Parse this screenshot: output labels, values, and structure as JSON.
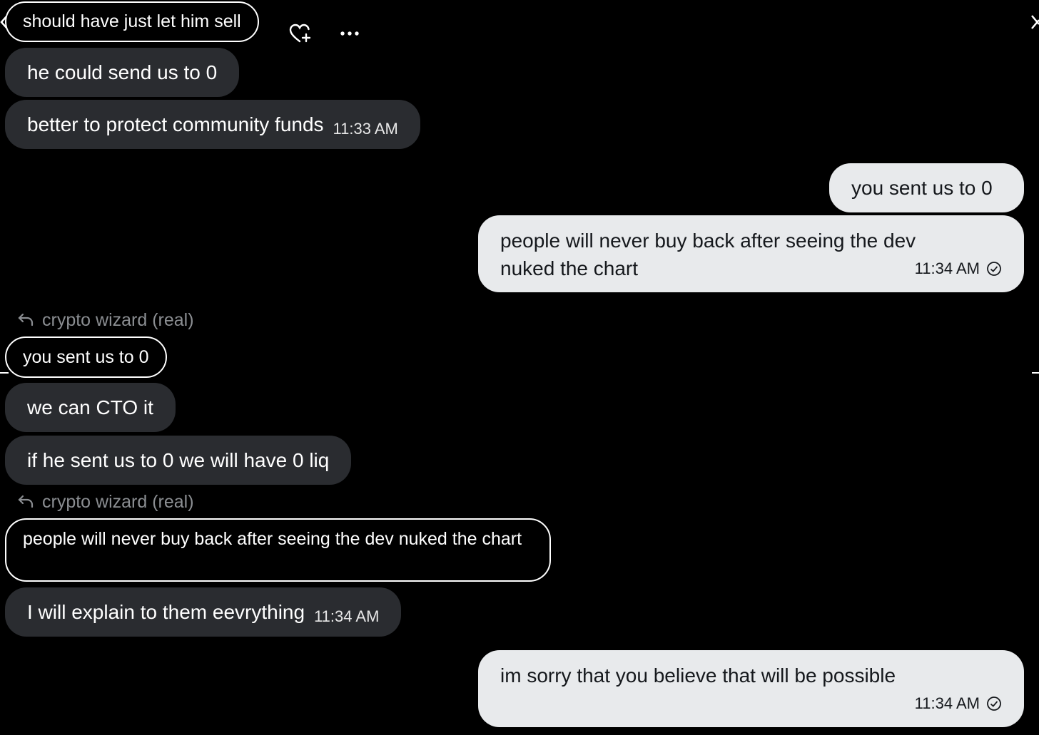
{
  "top_quote": {
    "text": "should have just let him sell"
  },
  "actions": {
    "react_icon": "heart-plus-icon",
    "more_icon": "more-icon"
  },
  "messages": [
    {
      "text": "he could send us to 0"
    },
    {
      "text": "better to protect community funds",
      "time": "11:33 AM"
    },
    {
      "text": "you sent us to 0"
    },
    {
      "line1": "people will never buy back after seeing the dev",
      "line2": "nuked the chart",
      "time": "11:34 AM"
    },
    {
      "text": "we can CTO it"
    },
    {
      "text": "if he sent us to 0 we will have 0 liq"
    },
    {
      "text": "I will explain to them eevrything",
      "time": "11:34 AM"
    },
    {
      "text": "im sorry that you believe that will be possible",
      "time": "11:34 AM"
    }
  ],
  "replies": [
    {
      "to": "crypto wizard (real)",
      "quote": "you sent us to 0"
    },
    {
      "to": "crypto wizard (real)",
      "quote": "people will never buy back after seeing the dev nuked the chart"
    }
  ],
  "colors": {
    "background": "#000000",
    "incoming": "#2a2c30",
    "outgoing": "#e8eaec"
  }
}
